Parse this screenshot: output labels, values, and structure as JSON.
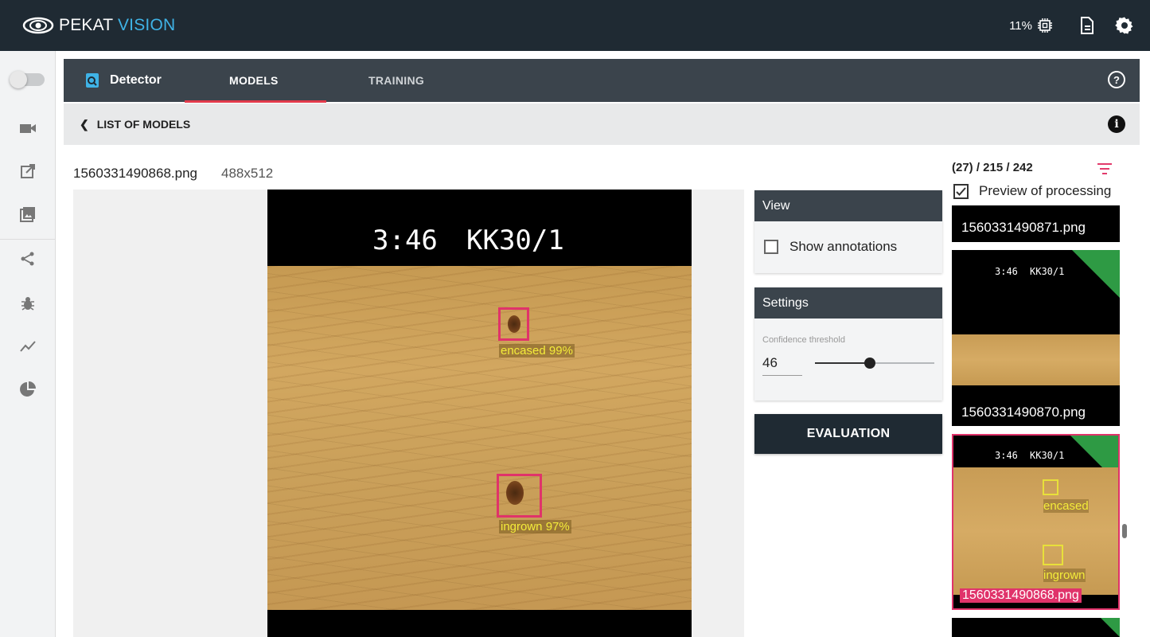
{
  "app": {
    "logo_part1": "PEKAT",
    "logo_part2": "VISION",
    "cpu_usage": "11%"
  },
  "header": {
    "module": "Detector",
    "tabs": [
      {
        "label": "MODELS",
        "active": true
      },
      {
        "label": "TRAINING",
        "active": false
      }
    ]
  },
  "subbar": {
    "back_label": "LIST OF MODELS"
  },
  "image": {
    "filename": "1560331490868.png",
    "dimensions": "488x512",
    "overlay_time": "3:46",
    "overlay_code": "KK30/1",
    "detections": [
      {
        "label": "encased 99%"
      },
      {
        "label": "ingrown 97%"
      }
    ]
  },
  "view_panel": {
    "title": "View",
    "show_annotations_label": "Show annotations",
    "show_annotations_checked": false
  },
  "settings_panel": {
    "title": "Settings",
    "confidence_label": "Confidence threshold",
    "confidence_value": "46",
    "slider_fraction": 0.46
  },
  "evaluation_button": "EVALUATION",
  "gallery": {
    "counts": "(27) / 215 / 242",
    "preview_label": "Preview of processing",
    "preview_checked": true,
    "thumbnails": [
      {
        "name": "1560331490871.png"
      },
      {
        "name": "1560331490870.png",
        "overlay_time": "3:46",
        "overlay_code": "KK30/1"
      },
      {
        "name": "1560331490868.png",
        "overlay_time": "3:46",
        "overlay_code": "KK30/1",
        "labels": [
          "encased",
          "ingrown"
        ],
        "selected": true
      }
    ]
  },
  "colors": {
    "topbar": "#1f2a33",
    "panel_head": "#3b444c",
    "accent_red": "#e23b4c",
    "bbox_pink": "#e0336a",
    "label_yellow": "#f4ec3a",
    "ok_green": "#2e9a44"
  },
  "icons": {
    "sidebar": [
      "toggle",
      "camera-icon",
      "edit-icon",
      "image-icon",
      "share-icon",
      "bug-icon",
      "chart-line-icon",
      "pie-chart-icon"
    ],
    "topbar": [
      "cpu-icon",
      "document-icon",
      "gear-icon"
    ]
  }
}
